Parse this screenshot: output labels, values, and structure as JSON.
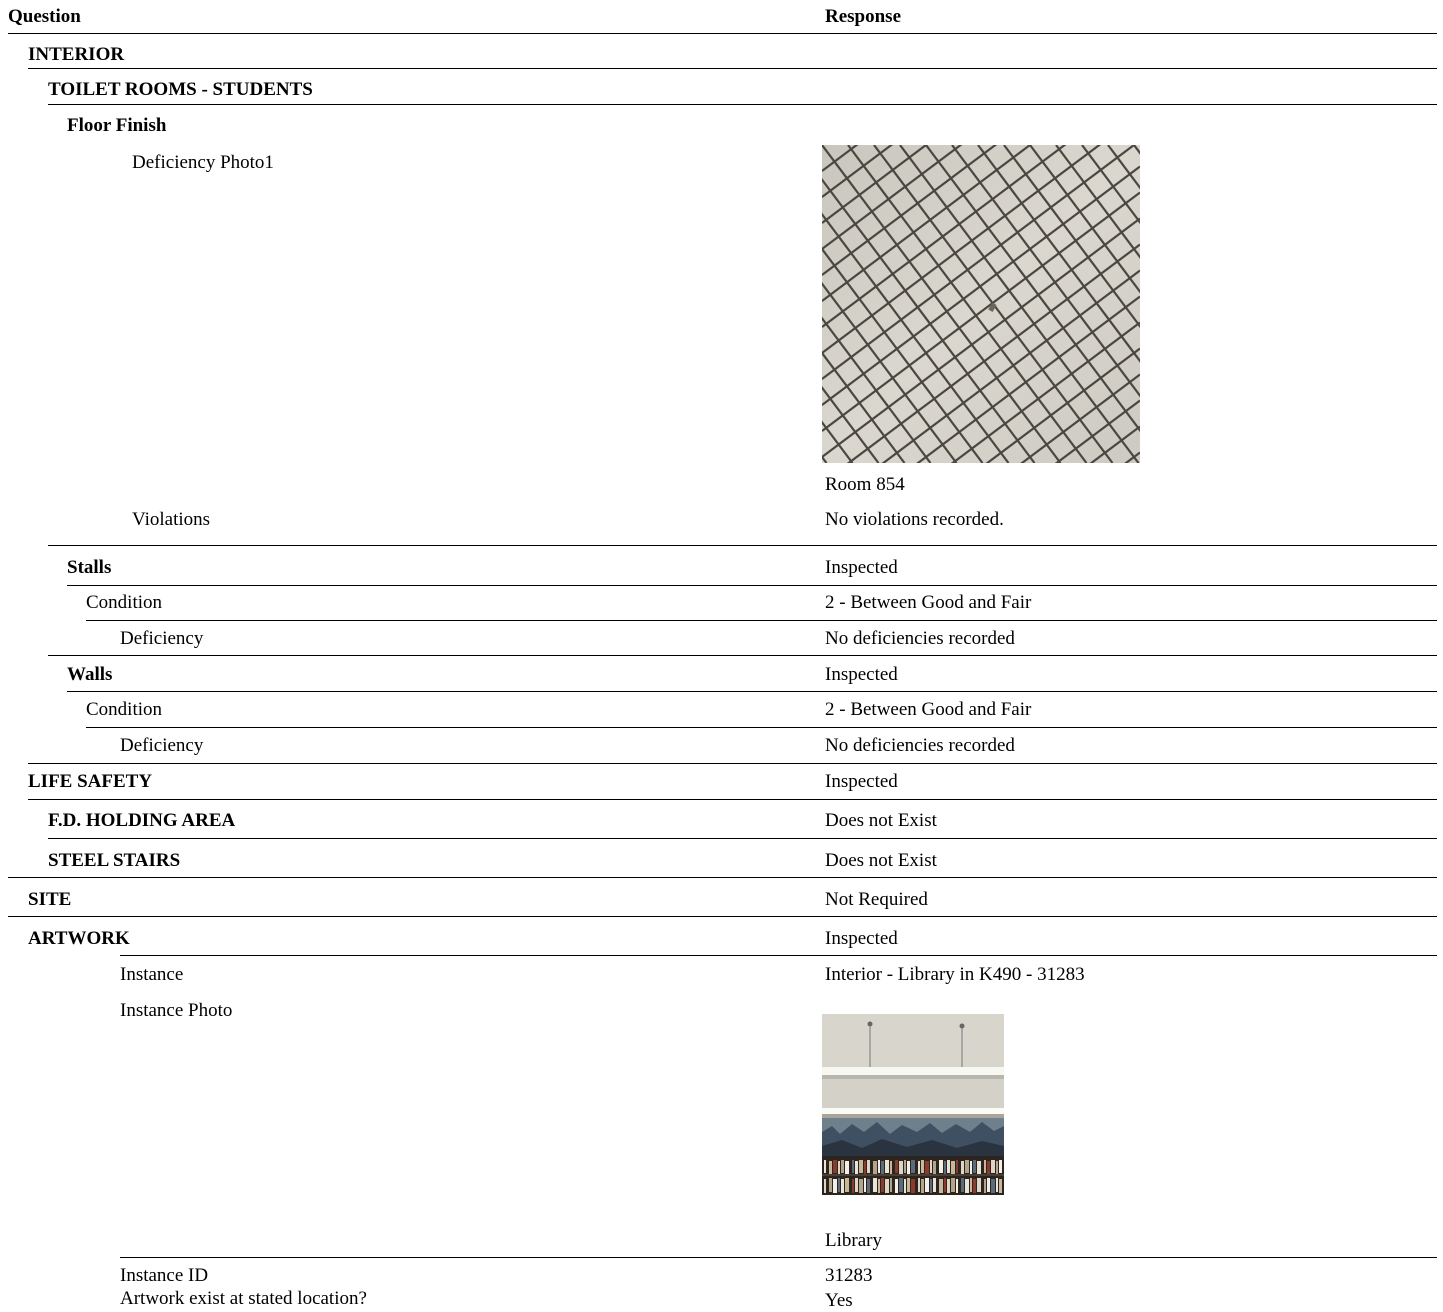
{
  "header": {
    "question": "Question",
    "response": "Response"
  },
  "sections": {
    "interior": "INTERIOR",
    "toilet_rooms": "TOILET ROOMS - STUDENTS",
    "floor_finish": {
      "label": "Floor Finish",
      "photo_label": "Deficiency Photo1",
      "photo_caption": "Room 854",
      "violations_label": "Violations",
      "violations_value": "No violations recorded."
    },
    "stalls": {
      "label": "Stalls",
      "value": "Inspected",
      "condition_label": "Condition",
      "condition_value": "2 - Between Good and Fair",
      "deficiency_label": "Deficiency",
      "deficiency_value": "No deficiencies recorded"
    },
    "walls": {
      "label": "Walls",
      "value": "Inspected",
      "condition_label": "Condition",
      "condition_value": "2 - Between Good and Fair",
      "deficiency_label": "Deficiency",
      "deficiency_value": "No deficiencies recorded"
    },
    "life_safety": {
      "label": "LIFE SAFETY",
      "value": "Inspected"
    },
    "fd_holding": {
      "label": "F.D. HOLDING AREA",
      "value": "Does not Exist"
    },
    "steel_stairs": {
      "label": "STEEL STAIRS",
      "value": "Does not Exist"
    },
    "site": {
      "label": "SITE",
      "value": "Not Required"
    },
    "artwork": {
      "label": "ARTWORK",
      "value": "Inspected",
      "instance_label": "Instance",
      "instance_value": "Interior - Library in K490 - 31283",
      "instance_photo_label": "Instance Photo",
      "instance_photo_caption": "Library",
      "instance_id_label": "Instance ID",
      "instance_id_value": "31283",
      "exist_label": "Artwork exist at stated location?",
      "exist_value": "Yes"
    }
  }
}
